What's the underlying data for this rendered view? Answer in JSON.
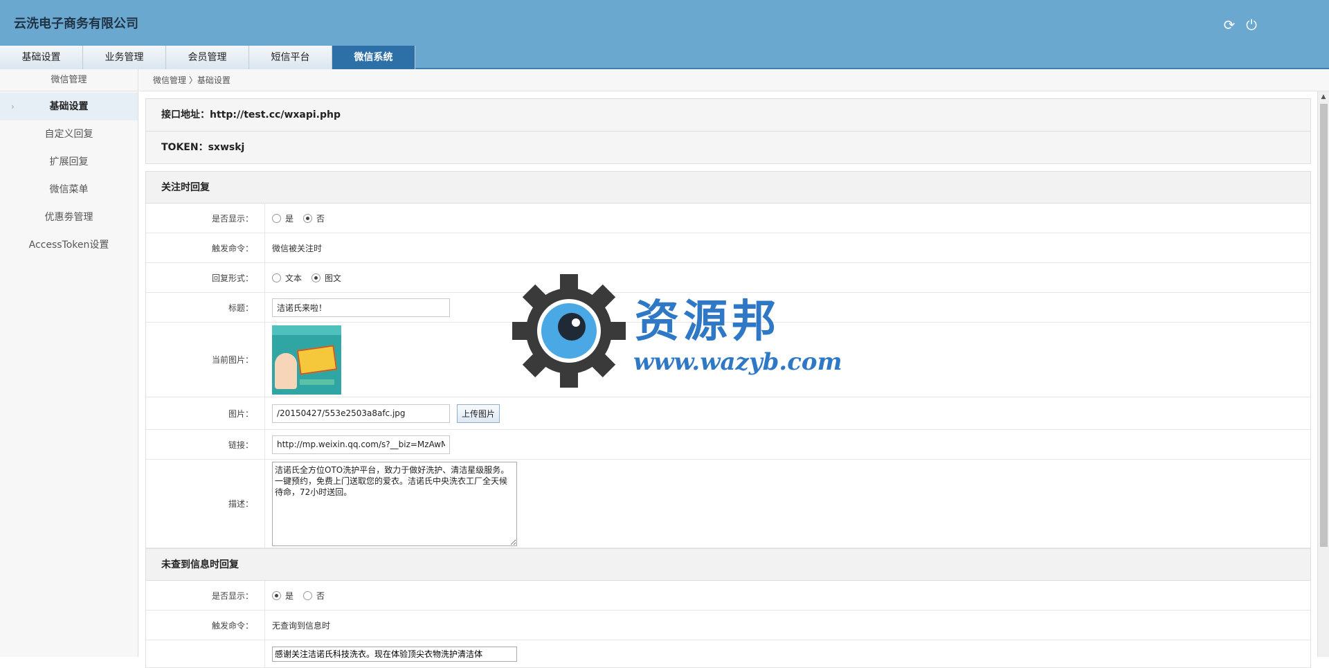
{
  "header": {
    "brand": "云洗电子商务有限公司",
    "icons": [
      "refresh-icon",
      "power-icon"
    ]
  },
  "nav": {
    "tabs": [
      "基础设置",
      "业务管理",
      "会员管理",
      "短信平台",
      "微信系统"
    ],
    "active": "微信系统"
  },
  "sidebar": {
    "header": "微信管理",
    "items": [
      "基础设置",
      "自定义回复",
      "扩展回复",
      "微信菜单",
      "优惠劵管理",
      "AccessToken设置"
    ],
    "active": "基础设置"
  },
  "breadcrumb": "微信管理 〉基础设置",
  "info": {
    "api": "接口地址：http://test.cc/wxapi.php",
    "token": "TOKEN：sxwskj"
  },
  "follow_reply": {
    "title": "关注时回复",
    "show_label": "是否显示：",
    "show_options": [
      "是",
      "否"
    ],
    "show_selected": "否",
    "trigger_label": "触发命令：",
    "trigger_value": "微信被关注时",
    "mode_label": "回复形式：",
    "mode_options": [
      "文本",
      "图文"
    ],
    "mode_selected": "图文",
    "headline_label": "标题：",
    "headline_value": "洁诺氏来啦！",
    "current_image_label": "当前图片：",
    "image_label": "图片：",
    "image_value": "/20150427/553e2503a8afc.jpg",
    "upload_button": "上传图片",
    "link_label": "链接：",
    "link_value": "http://mp.weixin.qq.com/s?__biz=MzAwMz",
    "desc_label": "描述：",
    "desc_value": "洁诺氏全方位OTO洗护平台，致力于做好洗护、清洁星级服务。\n一键预约，免费上门送取您的爱衣。洁诺氏中央洗衣工厂全天候待命，72小时送回。"
  },
  "notfound_reply": {
    "title": "未查到信息时回复",
    "show_label": "是否显示：",
    "show_options": [
      "是",
      "否"
    ],
    "show_selected": "是",
    "trigger_label": "触发命令：",
    "trigger_value": "无查询到信息时",
    "desc_value": "感谢关注洁诺氏科技洗衣。现在体验顶尖衣物洗护清洁体"
  },
  "watermark": {
    "text": "资源邦",
    "url": "www.wazyb.com",
    "color": "#2f78c6"
  }
}
